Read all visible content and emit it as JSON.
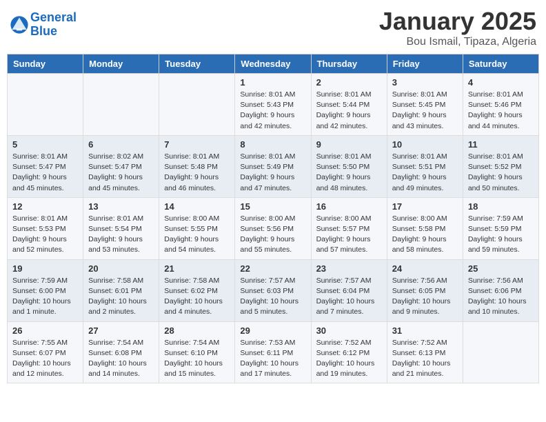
{
  "header": {
    "logo_line1": "General",
    "logo_line2": "Blue",
    "month": "January 2025",
    "location": "Bou Ismail, Tipaza, Algeria"
  },
  "days": [
    "Sunday",
    "Monday",
    "Tuesday",
    "Wednesday",
    "Thursday",
    "Friday",
    "Saturday"
  ],
  "weeks": [
    [
      {
        "num": "",
        "info": ""
      },
      {
        "num": "",
        "info": ""
      },
      {
        "num": "",
        "info": ""
      },
      {
        "num": "1",
        "info": "Sunrise: 8:01 AM\nSunset: 5:43 PM\nDaylight: 9 hours\nand 42 minutes."
      },
      {
        "num": "2",
        "info": "Sunrise: 8:01 AM\nSunset: 5:44 PM\nDaylight: 9 hours\nand 42 minutes."
      },
      {
        "num": "3",
        "info": "Sunrise: 8:01 AM\nSunset: 5:45 PM\nDaylight: 9 hours\nand 43 minutes."
      },
      {
        "num": "4",
        "info": "Sunrise: 8:01 AM\nSunset: 5:46 PM\nDaylight: 9 hours\nand 44 minutes."
      }
    ],
    [
      {
        "num": "5",
        "info": "Sunrise: 8:01 AM\nSunset: 5:47 PM\nDaylight: 9 hours\nand 45 minutes."
      },
      {
        "num": "6",
        "info": "Sunrise: 8:02 AM\nSunset: 5:47 PM\nDaylight: 9 hours\nand 45 minutes."
      },
      {
        "num": "7",
        "info": "Sunrise: 8:01 AM\nSunset: 5:48 PM\nDaylight: 9 hours\nand 46 minutes."
      },
      {
        "num": "8",
        "info": "Sunrise: 8:01 AM\nSunset: 5:49 PM\nDaylight: 9 hours\nand 47 minutes."
      },
      {
        "num": "9",
        "info": "Sunrise: 8:01 AM\nSunset: 5:50 PM\nDaylight: 9 hours\nand 48 minutes."
      },
      {
        "num": "10",
        "info": "Sunrise: 8:01 AM\nSunset: 5:51 PM\nDaylight: 9 hours\nand 49 minutes."
      },
      {
        "num": "11",
        "info": "Sunrise: 8:01 AM\nSunset: 5:52 PM\nDaylight: 9 hours\nand 50 minutes."
      }
    ],
    [
      {
        "num": "12",
        "info": "Sunrise: 8:01 AM\nSunset: 5:53 PM\nDaylight: 9 hours\nand 52 minutes."
      },
      {
        "num": "13",
        "info": "Sunrise: 8:01 AM\nSunset: 5:54 PM\nDaylight: 9 hours\nand 53 minutes."
      },
      {
        "num": "14",
        "info": "Sunrise: 8:00 AM\nSunset: 5:55 PM\nDaylight: 9 hours\nand 54 minutes."
      },
      {
        "num": "15",
        "info": "Sunrise: 8:00 AM\nSunset: 5:56 PM\nDaylight: 9 hours\nand 55 minutes."
      },
      {
        "num": "16",
        "info": "Sunrise: 8:00 AM\nSunset: 5:57 PM\nDaylight: 9 hours\nand 57 minutes."
      },
      {
        "num": "17",
        "info": "Sunrise: 8:00 AM\nSunset: 5:58 PM\nDaylight: 9 hours\nand 58 minutes."
      },
      {
        "num": "18",
        "info": "Sunrise: 7:59 AM\nSunset: 5:59 PM\nDaylight: 9 hours\nand 59 minutes."
      }
    ],
    [
      {
        "num": "19",
        "info": "Sunrise: 7:59 AM\nSunset: 6:00 PM\nDaylight: 10 hours\nand 1 minute."
      },
      {
        "num": "20",
        "info": "Sunrise: 7:58 AM\nSunset: 6:01 PM\nDaylight: 10 hours\nand 2 minutes."
      },
      {
        "num": "21",
        "info": "Sunrise: 7:58 AM\nSunset: 6:02 PM\nDaylight: 10 hours\nand 4 minutes."
      },
      {
        "num": "22",
        "info": "Sunrise: 7:57 AM\nSunset: 6:03 PM\nDaylight: 10 hours\nand 5 minutes."
      },
      {
        "num": "23",
        "info": "Sunrise: 7:57 AM\nSunset: 6:04 PM\nDaylight: 10 hours\nand 7 minutes."
      },
      {
        "num": "24",
        "info": "Sunrise: 7:56 AM\nSunset: 6:05 PM\nDaylight: 10 hours\nand 9 minutes."
      },
      {
        "num": "25",
        "info": "Sunrise: 7:56 AM\nSunset: 6:06 PM\nDaylight: 10 hours\nand 10 minutes."
      }
    ],
    [
      {
        "num": "26",
        "info": "Sunrise: 7:55 AM\nSunset: 6:07 PM\nDaylight: 10 hours\nand 12 minutes."
      },
      {
        "num": "27",
        "info": "Sunrise: 7:54 AM\nSunset: 6:08 PM\nDaylight: 10 hours\nand 14 minutes."
      },
      {
        "num": "28",
        "info": "Sunrise: 7:54 AM\nSunset: 6:10 PM\nDaylight: 10 hours\nand 15 minutes."
      },
      {
        "num": "29",
        "info": "Sunrise: 7:53 AM\nSunset: 6:11 PM\nDaylight: 10 hours\nand 17 minutes."
      },
      {
        "num": "30",
        "info": "Sunrise: 7:52 AM\nSunset: 6:12 PM\nDaylight: 10 hours\nand 19 minutes."
      },
      {
        "num": "31",
        "info": "Sunrise: 7:52 AM\nSunset: 6:13 PM\nDaylight: 10 hours\nand 21 minutes."
      },
      {
        "num": "",
        "info": ""
      }
    ]
  ]
}
